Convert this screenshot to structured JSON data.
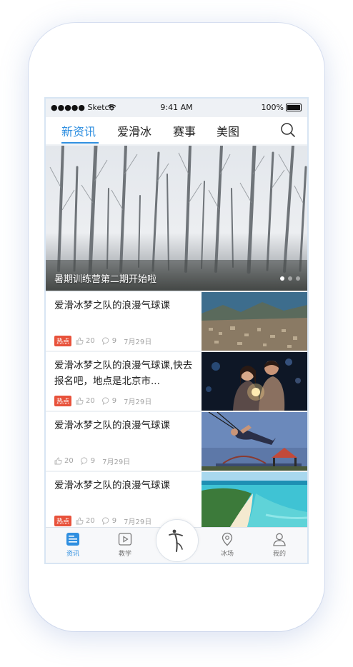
{
  "status": {
    "carrier": "●●●●● Sketch",
    "time": "9:41 AM",
    "battery": "100%"
  },
  "tabs": [
    {
      "label": "新资讯",
      "active": true
    },
    {
      "label": "爱滑冰",
      "active": false
    },
    {
      "label": "赛事",
      "active": false
    },
    {
      "label": "美图",
      "active": false
    }
  ],
  "banner": {
    "caption": "暑期训练营第二期开始啦",
    "dots": 3,
    "active_dot": 0
  },
  "news": [
    {
      "title": "爱滑冰梦之队的浪漫气球课",
      "hot": "热点",
      "likes": "20",
      "comments": "9",
      "date": "7月29日"
    },
    {
      "title": "爱滑冰梦之队的浪漫气球课,快去报名吧，地点是北京市...",
      "hot": "热点",
      "likes": "20",
      "comments": "9",
      "date": "7月29日"
    },
    {
      "title": "爱滑冰梦之队的浪漫气球课",
      "hot": "",
      "likes": "20",
      "comments": "9",
      "date": "7月29日"
    },
    {
      "title": "爱滑冰梦之队的浪漫气球课",
      "hot": "热点",
      "likes": "20",
      "comments": "9",
      "date": "7月29日"
    }
  ],
  "tabbar": {
    "news": "资讯",
    "teach": "教学",
    "rink": "冰场",
    "mine": "我的"
  },
  "colors": {
    "accent": "#2f8fe0",
    "hot": "#e8523b"
  }
}
